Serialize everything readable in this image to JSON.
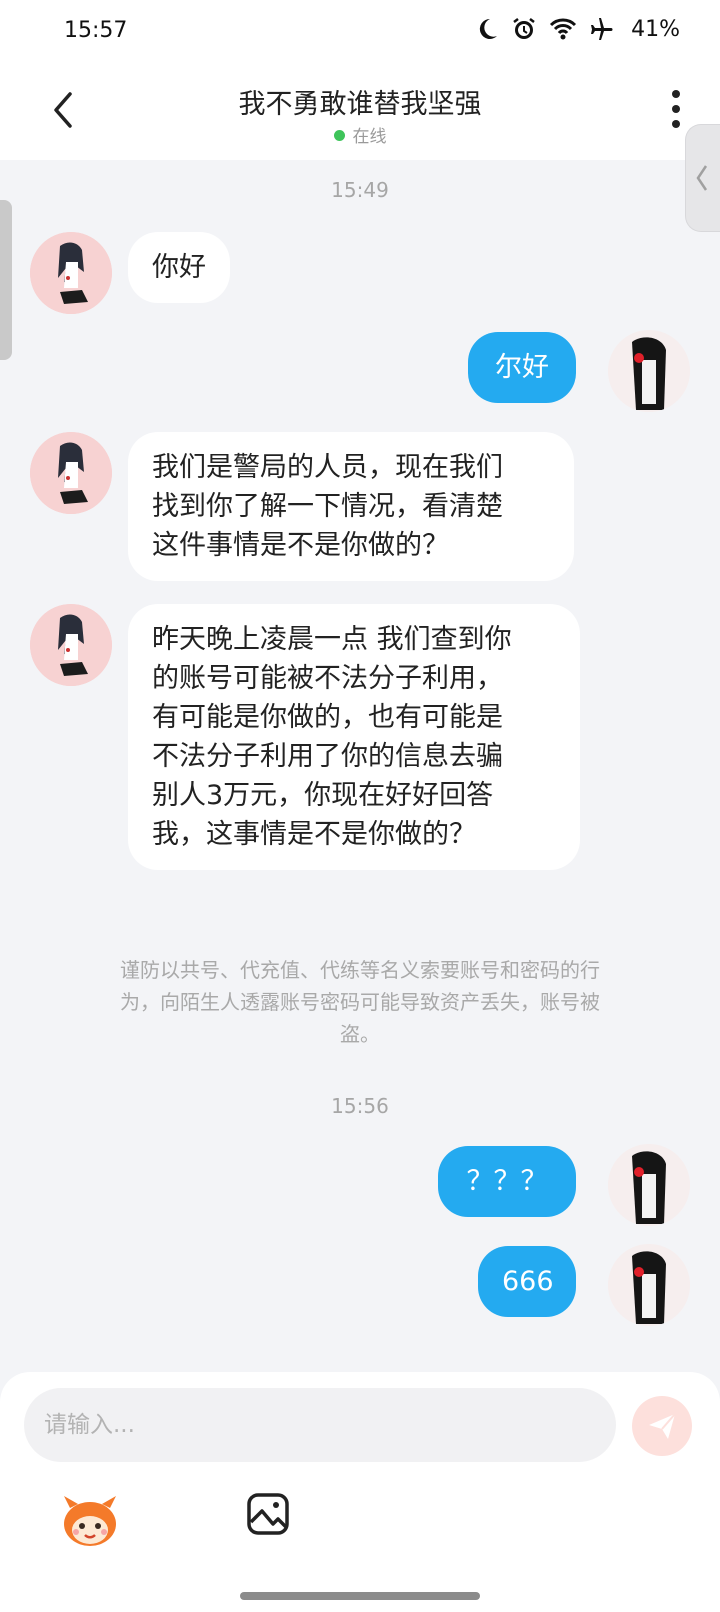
{
  "status_bar": {
    "time": "15:57",
    "battery": "41%",
    "icons": [
      "moon-icon",
      "alarm-icon",
      "wifi-icon",
      "airplane-icon"
    ]
  },
  "header": {
    "title": "我不勇敢谁替我坚强",
    "status": "在线",
    "status_color": "#3ec45a"
  },
  "messages": {
    "time1": "15:49",
    "m1": "你好",
    "m2": "尔好",
    "m3_line1": "我们是警局的人员，现在我们",
    "m3_line2": "找到你了解一下情况，看清楚",
    "m3_line3": "这件事情是不是你做的？",
    "m4_line1": "昨天晚上凌晨一点 我们查到你",
    "m4_line2": "的账号可能被不法分子利用，",
    "m4_line3": "有可能是你做的，也有可能是",
    "m4_line4": "不法分子利用了你的信息去骗",
    "m4_line5": "别人3万元，你现在好好回答",
    "m4_line6": "我，这事情是不是你做的？",
    "notice_line1": "谨防以共号、代充值、代练等名义索要账号和密码的行",
    "notice_line2": "为，向陌生人透露账号密码可能导致资产丢失，账号被",
    "notice_line3": "盗。",
    "time2": "15:56",
    "m5": "？？？",
    "m6": "666"
  },
  "input": {
    "placeholder": "请输入..."
  },
  "colors": {
    "outgoing_bubble": "#24aaf0",
    "incoming_bubble": "#ffffff",
    "background": "#f3f4f7"
  }
}
